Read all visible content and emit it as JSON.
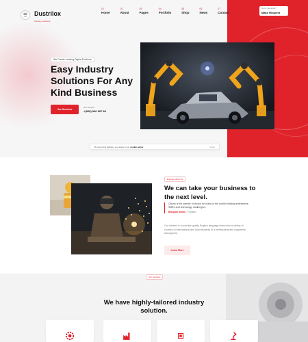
{
  "brand": {
    "name": "Dustrilox",
    "tagline": "Industry solutions"
  },
  "nav": [
    {
      "num": "01",
      "label": "Home"
    },
    {
      "num": "02",
      "label": "About"
    },
    {
      "num": "03",
      "label": "Pages"
    },
    {
      "num": "04",
      "label": "Portfolio"
    },
    {
      "num": "05",
      "label": "Shop"
    },
    {
      "num": "06",
      "label": "News"
    },
    {
      "num": "07",
      "label": "Contact"
    }
  ],
  "help": {
    "question": "Got a Question?",
    "action": "Make Request"
  },
  "hero": {
    "tagline": "We Create Leading Digital Products",
    "headline": "Easy Industry Solutions For Any Kind Business",
    "cta": "Our Services",
    "phone_label": "Get Support",
    "phone": "+(960) 960 997 89"
  },
  "cookie": {
    "text": "By using this website, you agree to our",
    "link": "cookie policy",
    "close": "Close"
  },
  "about": {
    "eyebrow": "Explore About Us",
    "heading": "We can take your business to the next level.",
    "quote": "Citicris is the partner of choice for many of the world's leading enterprises, SMEs and technology challengers.",
    "author_name": "Bhuyiaro Sehan",
    "author_role": "- Founder",
    "body": "Our mission is to provide quality English language instruction a variety of courses to international and local students in a professional and supportive atmosphere.",
    "cta": "Learn More"
  },
  "services": {
    "eyebrow": "Our Services",
    "heading": "We have highly-tailored industry solution."
  },
  "colors": {
    "accent": "#e0232b",
    "dark": "#111111",
    "muted": "#777777"
  }
}
